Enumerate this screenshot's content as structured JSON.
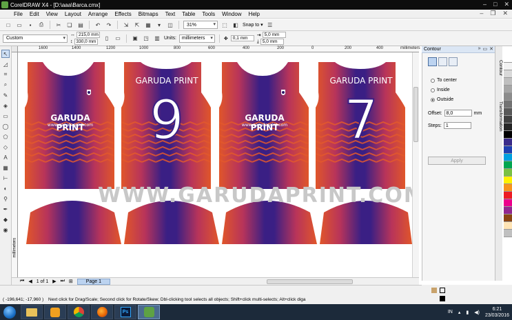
{
  "window": {
    "title": "CorelDRAW X4 - [D:\\aaa\\Barca.cmx]",
    "controls": [
      "–",
      "□",
      "✕"
    ]
  },
  "menu": {
    "items": [
      "File",
      "Edit",
      "View",
      "Layout",
      "Arrange",
      "Effects",
      "Bitmaps",
      "Text",
      "Table",
      "Tools",
      "Window",
      "Help"
    ]
  },
  "toolbar": {
    "zoom": "31%",
    "snap_to": "Snap to"
  },
  "property_bar": {
    "page_size": "Custom",
    "width": "215,0 mm",
    "height": "330,0 mm",
    "units_label": "Units:",
    "units": "millimeters",
    "nudge": "0,1 mm",
    "dup_x": "5,0 mm",
    "dup_y": "5,0 mm"
  },
  "ruler": {
    "h_labels": [
      "1600",
      "1400",
      "1200",
      "1000",
      "800",
      "600",
      "400",
      "200",
      "0",
      "200",
      "400",
      "millimeters"
    ],
    "v_labels": [
      "millimeters"
    ]
  },
  "canvas": {
    "watermark": "WWW.GARUDAPRINT.COM",
    "jerseys": [
      {
        "type": "front",
        "brand": "GARUDA PRINT",
        "url": "www.garudaprint.com"
      },
      {
        "type": "back",
        "brand": "GARUDA PRINT",
        "number": "9"
      },
      {
        "type": "front",
        "brand": "GARUDA PRINT",
        "url": "www.garudaprint.com"
      },
      {
        "type": "back",
        "brand": "GARUDA PRINT",
        "number": "7"
      }
    ]
  },
  "colors": {
    "purple": "#4a1f8f",
    "deep_purple": "#2d1a6b",
    "orange": "#e8582a",
    "red_orange": "#d53a2e",
    "docker_header": "#dbe6f4"
  },
  "pagebar": {
    "page_count": "1 of 1",
    "page_tab": "Page 1"
  },
  "docker": {
    "title": "Contour",
    "options": [
      "To center",
      "Inside",
      "Outside"
    ],
    "selected": "Outside",
    "offset_label": "Offset:",
    "offset_value": "8,0",
    "offset_unit": "mm",
    "steps_label": "Steps:",
    "steps_value": "1",
    "apply": "Apply",
    "side_tabs": [
      "Contour",
      "Transformation"
    ]
  },
  "palette": {
    "colors": [
      "#ffffff",
      "#f2f2f2",
      "#d9d9d9",
      "#bfbfbf",
      "#a6a6a6",
      "#8c8c8c",
      "#737373",
      "#595959",
      "#404040",
      "#262626",
      "#000000",
      "#3b2c8a",
      "#1f3fb0",
      "#00a0e0",
      "#00a650",
      "#7ac143",
      "#fff200",
      "#f7941d",
      "#ed1c24",
      "#ec008c",
      "#92278f",
      "#8b4513",
      "#ffe4b5",
      "#c0c0c0"
    ]
  },
  "status": {
    "coords": "( -196,641; -17,960 )",
    "hint": "Next click for Drag/Scale; Second click for Rotate/Skew; Dbl-clicking tool selects all objects; Shift+click multi-selects; Alt+click diga"
  },
  "taskbar": {
    "lang": "IN",
    "time": "6:21",
    "date": "23/03/2016"
  }
}
